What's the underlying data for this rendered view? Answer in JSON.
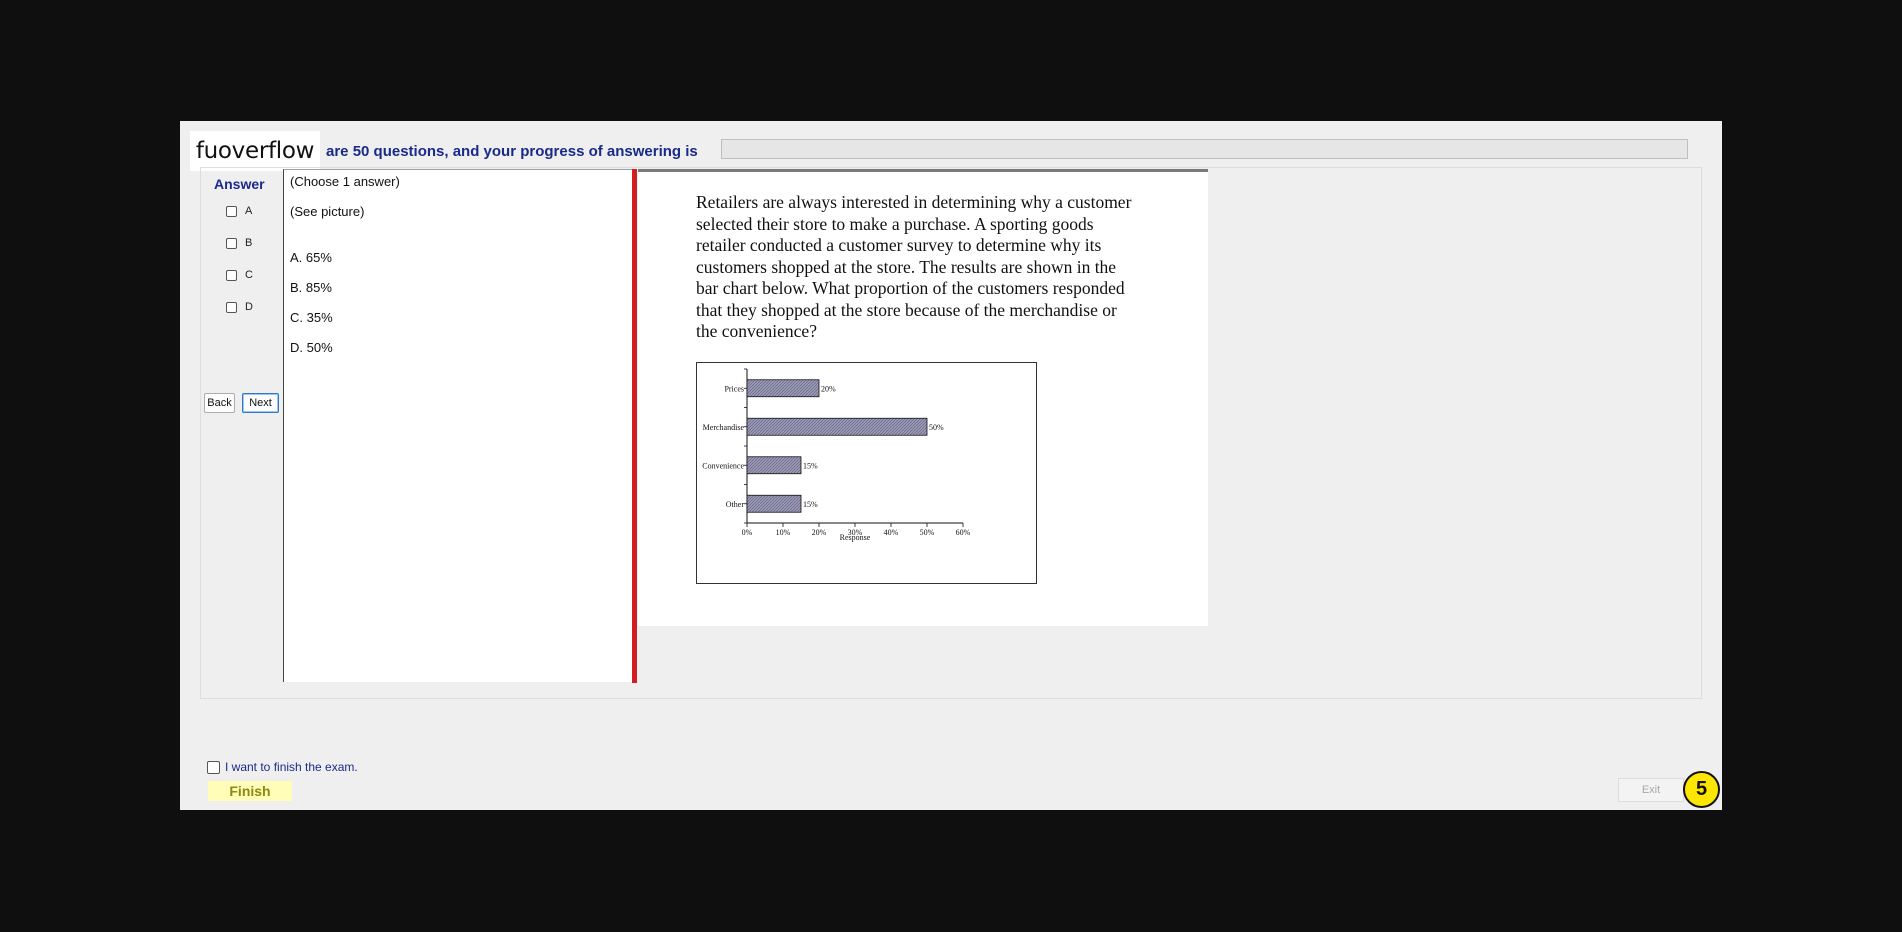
{
  "brand": "fuoverflow",
  "header": {
    "progress_text": "are 50 questions, and your progress of answering is",
    "progress_fraction": 0
  },
  "answer_sidebar": {
    "title": "Answer",
    "options": [
      {
        "letter": "A",
        "checked": false
      },
      {
        "letter": "B",
        "checked": false
      },
      {
        "letter": "C",
        "checked": false
      },
      {
        "letter": "D",
        "checked": false
      }
    ],
    "back_label": "Back",
    "next_label": "Next"
  },
  "answer_panel": {
    "instruction": "(Choose 1 answer)",
    "see_picture": "(See picture)",
    "choices": [
      "A.  65%",
      "B.  85%",
      "C.  35%",
      "D.  50%"
    ]
  },
  "question": {
    "lines": [
      "Retailers are always interested in determining why a customer",
      "selected their store to make a purchase. A sporting goods",
      "retailer conducted a customer survey to determine why its",
      "customers shopped at the store.  The results are shown in the",
      "bar chart below. What proportion of the customers responded",
      "that they shopped at the store because of the merchandise or",
      "the convenience?"
    ]
  },
  "chart_data": {
    "type": "bar",
    "orientation": "horizontal",
    "categories": [
      "Prices",
      "Merchandise",
      "Convenience",
      "Other"
    ],
    "values": [
      20,
      50,
      15,
      15
    ],
    "data_labels": [
      "20%",
      "50%",
      "15%",
      "15%"
    ],
    "xlabel": "Response",
    "xlim": [
      0,
      60
    ],
    "ticks": [
      "0%",
      "10%",
      "20%",
      "30%",
      "40%",
      "50%",
      "60%"
    ],
    "bar_color": "#9a9ab6"
  },
  "footer": {
    "finish_check_label": "I want to finish the exam.",
    "finish_label": "Finish",
    "exit_label": "Exit",
    "badge": "5"
  }
}
